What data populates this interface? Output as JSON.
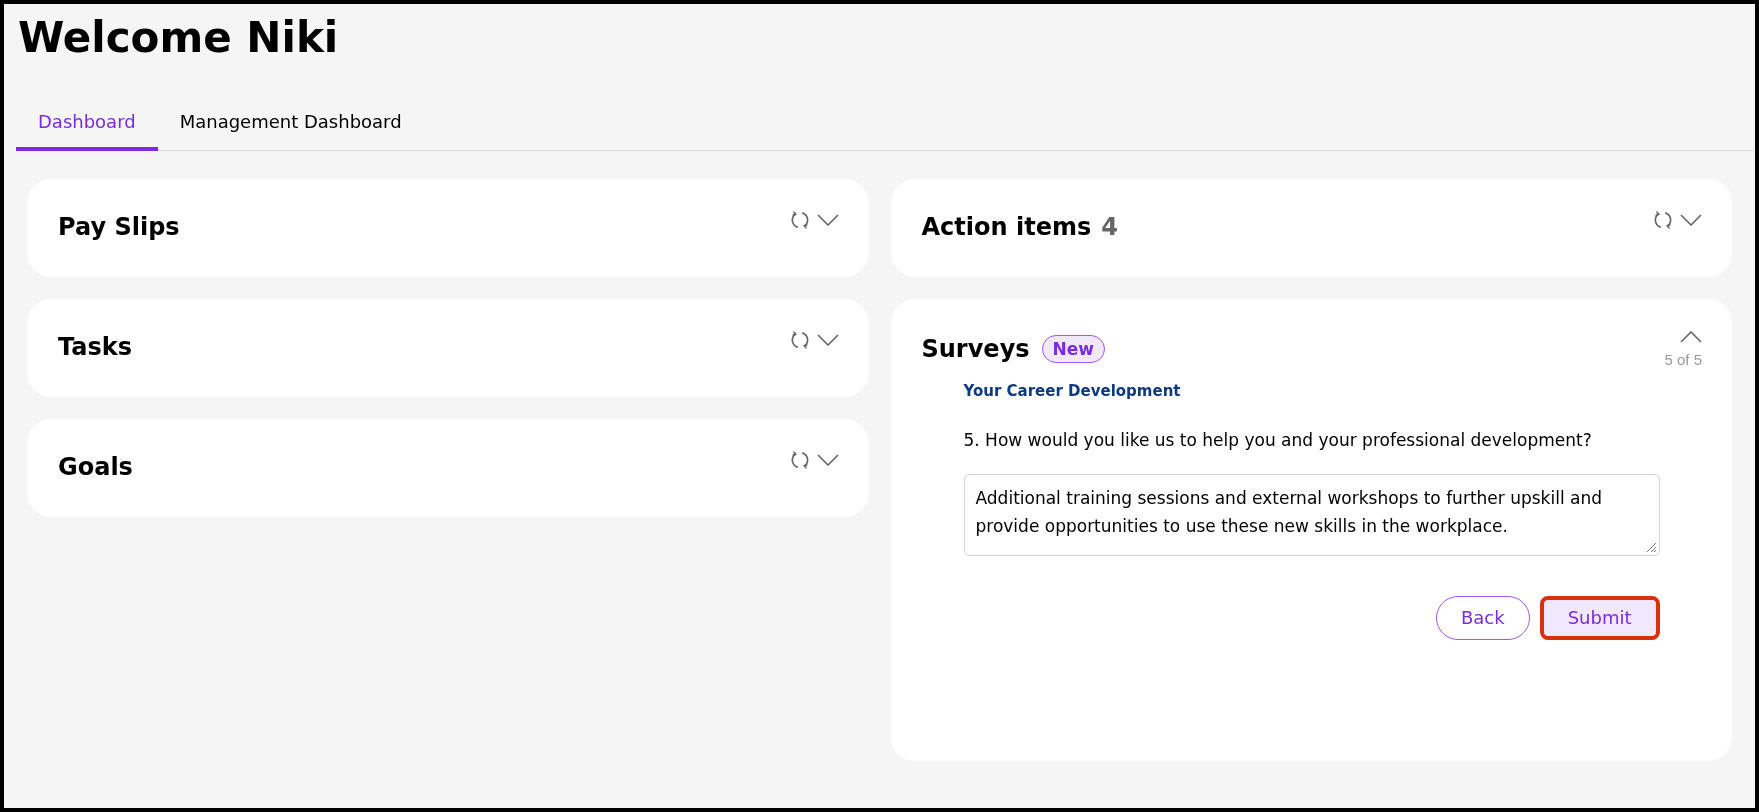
{
  "page": {
    "title": "Welcome Niki"
  },
  "tabs": [
    {
      "label": "Dashboard",
      "selected": true
    },
    {
      "label": "Management Dashboard",
      "selected": false
    }
  ],
  "left_cards": [
    {
      "title": "Pay Slips",
      "expanded": false
    },
    {
      "title": "Tasks",
      "expanded": false
    },
    {
      "title": "Goals",
      "expanded": false
    }
  ],
  "action_items": {
    "title": "Action items",
    "count": "4",
    "expanded": false
  },
  "surveys": {
    "title": "Surveys",
    "badge": "New",
    "expanded": true,
    "pager": "5 of 5",
    "section": "Your Career Development",
    "question": "5. How would you like us to help you and your professional development?",
    "answer": "Additional training sessions and external workshops to further upskill and provide opportunities to use these new skills in the workplace.",
    "buttons": [
      {
        "label": "Back",
        "kind": "outline",
        "highlighted": false
      },
      {
        "label": "Submit",
        "kind": "filled",
        "highlighted": true
      }
    ]
  }
}
